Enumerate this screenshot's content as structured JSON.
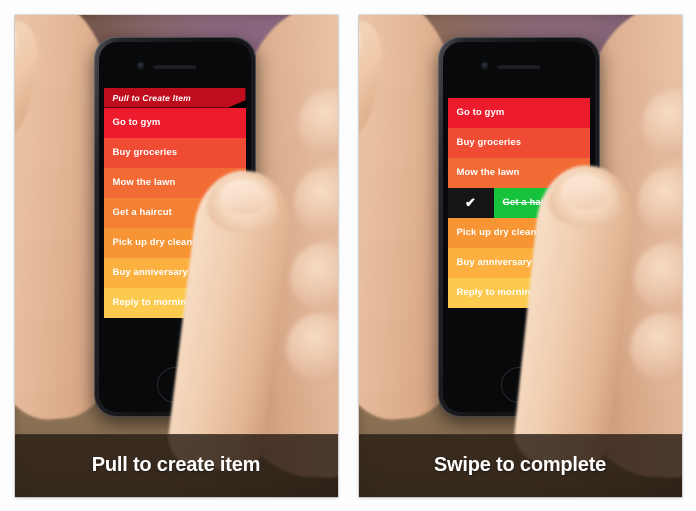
{
  "page": {
    "background_color": "#fdfdfd",
    "panel_count": 2
  },
  "panels": [
    {
      "id": "pull-to-create",
      "caption": "Pull to create item",
      "pull_tab": {
        "label": "Pull to Create Item",
        "color": "#c00d1e"
      },
      "rows": [
        {
          "label": "Go to gym",
          "color": "#ed1b2e",
          "state": "pending"
        },
        {
          "label": "Buy groceries",
          "color": "#f04b33",
          "state": "pending"
        },
        {
          "label": "Mow the lawn",
          "color": "#f26b35",
          "state": "pending"
        },
        {
          "label": "Get a haircut",
          "color": "#f57f32",
          "state": "pending"
        },
        {
          "label": "Pick up dry cleaning",
          "color": "#f79433",
          "state": "pending"
        },
        {
          "label": "Buy anniversary present",
          "color": "#fbb040",
          "state": "pending"
        },
        {
          "label": "Reply to morning emails",
          "color": "#fcca4e",
          "state": "pending"
        }
      ]
    },
    {
      "id": "swipe-to-complete",
      "caption": "Swipe to complete",
      "rows": [
        {
          "label": "Go to gym",
          "color": "#ed1b2e",
          "state": "pending"
        },
        {
          "label": "Buy groceries",
          "color": "#f04b33",
          "state": "pending"
        },
        {
          "label": "Mow the lawn",
          "color": "#f26b35",
          "state": "pending"
        },
        {
          "label": "Get a haircut",
          "color": "#16c23c",
          "state": "completed",
          "check_glyph": "✔",
          "check_cell_color": "#151515"
        },
        {
          "label": "Pick up dry cleaning",
          "color": "#f79433",
          "state": "pending"
        },
        {
          "label": "Buy anniversary present",
          "color": "#fbb040",
          "state": "pending"
        },
        {
          "label": "Reply to morning emails",
          "color": "#fcca4e",
          "state": "pending"
        }
      ]
    }
  ],
  "theme": {
    "caption_overlay": "rgba(38,26,18,.80)",
    "caption_text_color": "#ffffff",
    "row_text_color": "#ffffff",
    "completed_color": "#16c23c"
  }
}
